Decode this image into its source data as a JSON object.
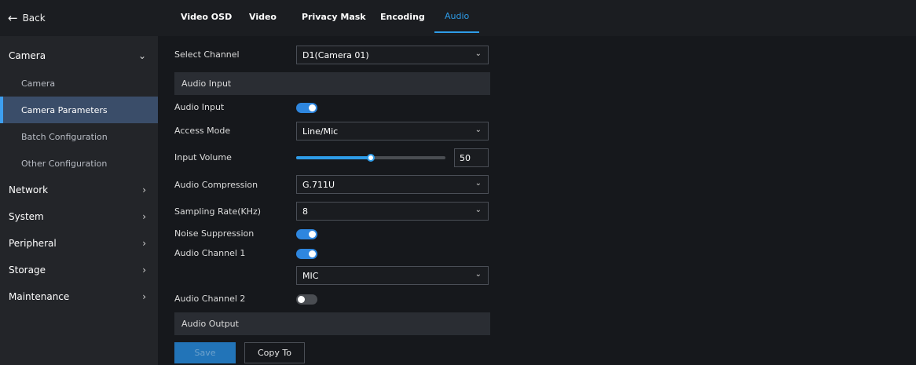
{
  "sidebar": {
    "back_label": "Back",
    "items": [
      {
        "label": "Camera"
      },
      {
        "label": "Network"
      },
      {
        "label": "System"
      },
      {
        "label": "Peripheral"
      },
      {
        "label": "Storage"
      },
      {
        "label": "Maintenance"
      }
    ],
    "sub_items": [
      {
        "label": "Camera"
      },
      {
        "label": "Camera Parameters"
      },
      {
        "label": "Batch Configuration"
      },
      {
        "label": "Other Configuration"
      }
    ]
  },
  "tabs": [
    {
      "label": "Video OSD"
    },
    {
      "label": "Video"
    },
    {
      "label": "Privacy Mask"
    },
    {
      "label": "Encoding"
    },
    {
      "label": "Audio"
    }
  ],
  "form": {
    "select_channel": {
      "label": "Select Channel",
      "value": "D1(Camera 01)"
    },
    "audio_input_section": "Audio Input",
    "audio_input": {
      "label": "Audio Input",
      "on": true
    },
    "access_mode": {
      "label": "Access Mode",
      "value": "Line/Mic"
    },
    "input_volume": {
      "label": "Input Volume",
      "value": "50",
      "level": 0.5
    },
    "audio_compression": {
      "label": "Audio Compression",
      "value": "G.711U"
    },
    "sampling_rate": {
      "label": "Sampling Rate(KHz)",
      "value": "8"
    },
    "noise_suppression": {
      "label": "Noise Suppression",
      "on": true
    },
    "audio_channel_1": {
      "label": "Audio Channel 1",
      "on": true,
      "source": "MIC"
    },
    "audio_channel_2": {
      "label": "Audio Channel 2",
      "on": false
    },
    "audio_output_section": "Audio Output"
  },
  "buttons": {
    "save_label": "Save",
    "copy_label": "Copy To"
  },
  "colors": {
    "accent": "#2e9ce8",
    "active_nav_bg": "#3a4d69",
    "toggle_on": "#2e86de"
  }
}
